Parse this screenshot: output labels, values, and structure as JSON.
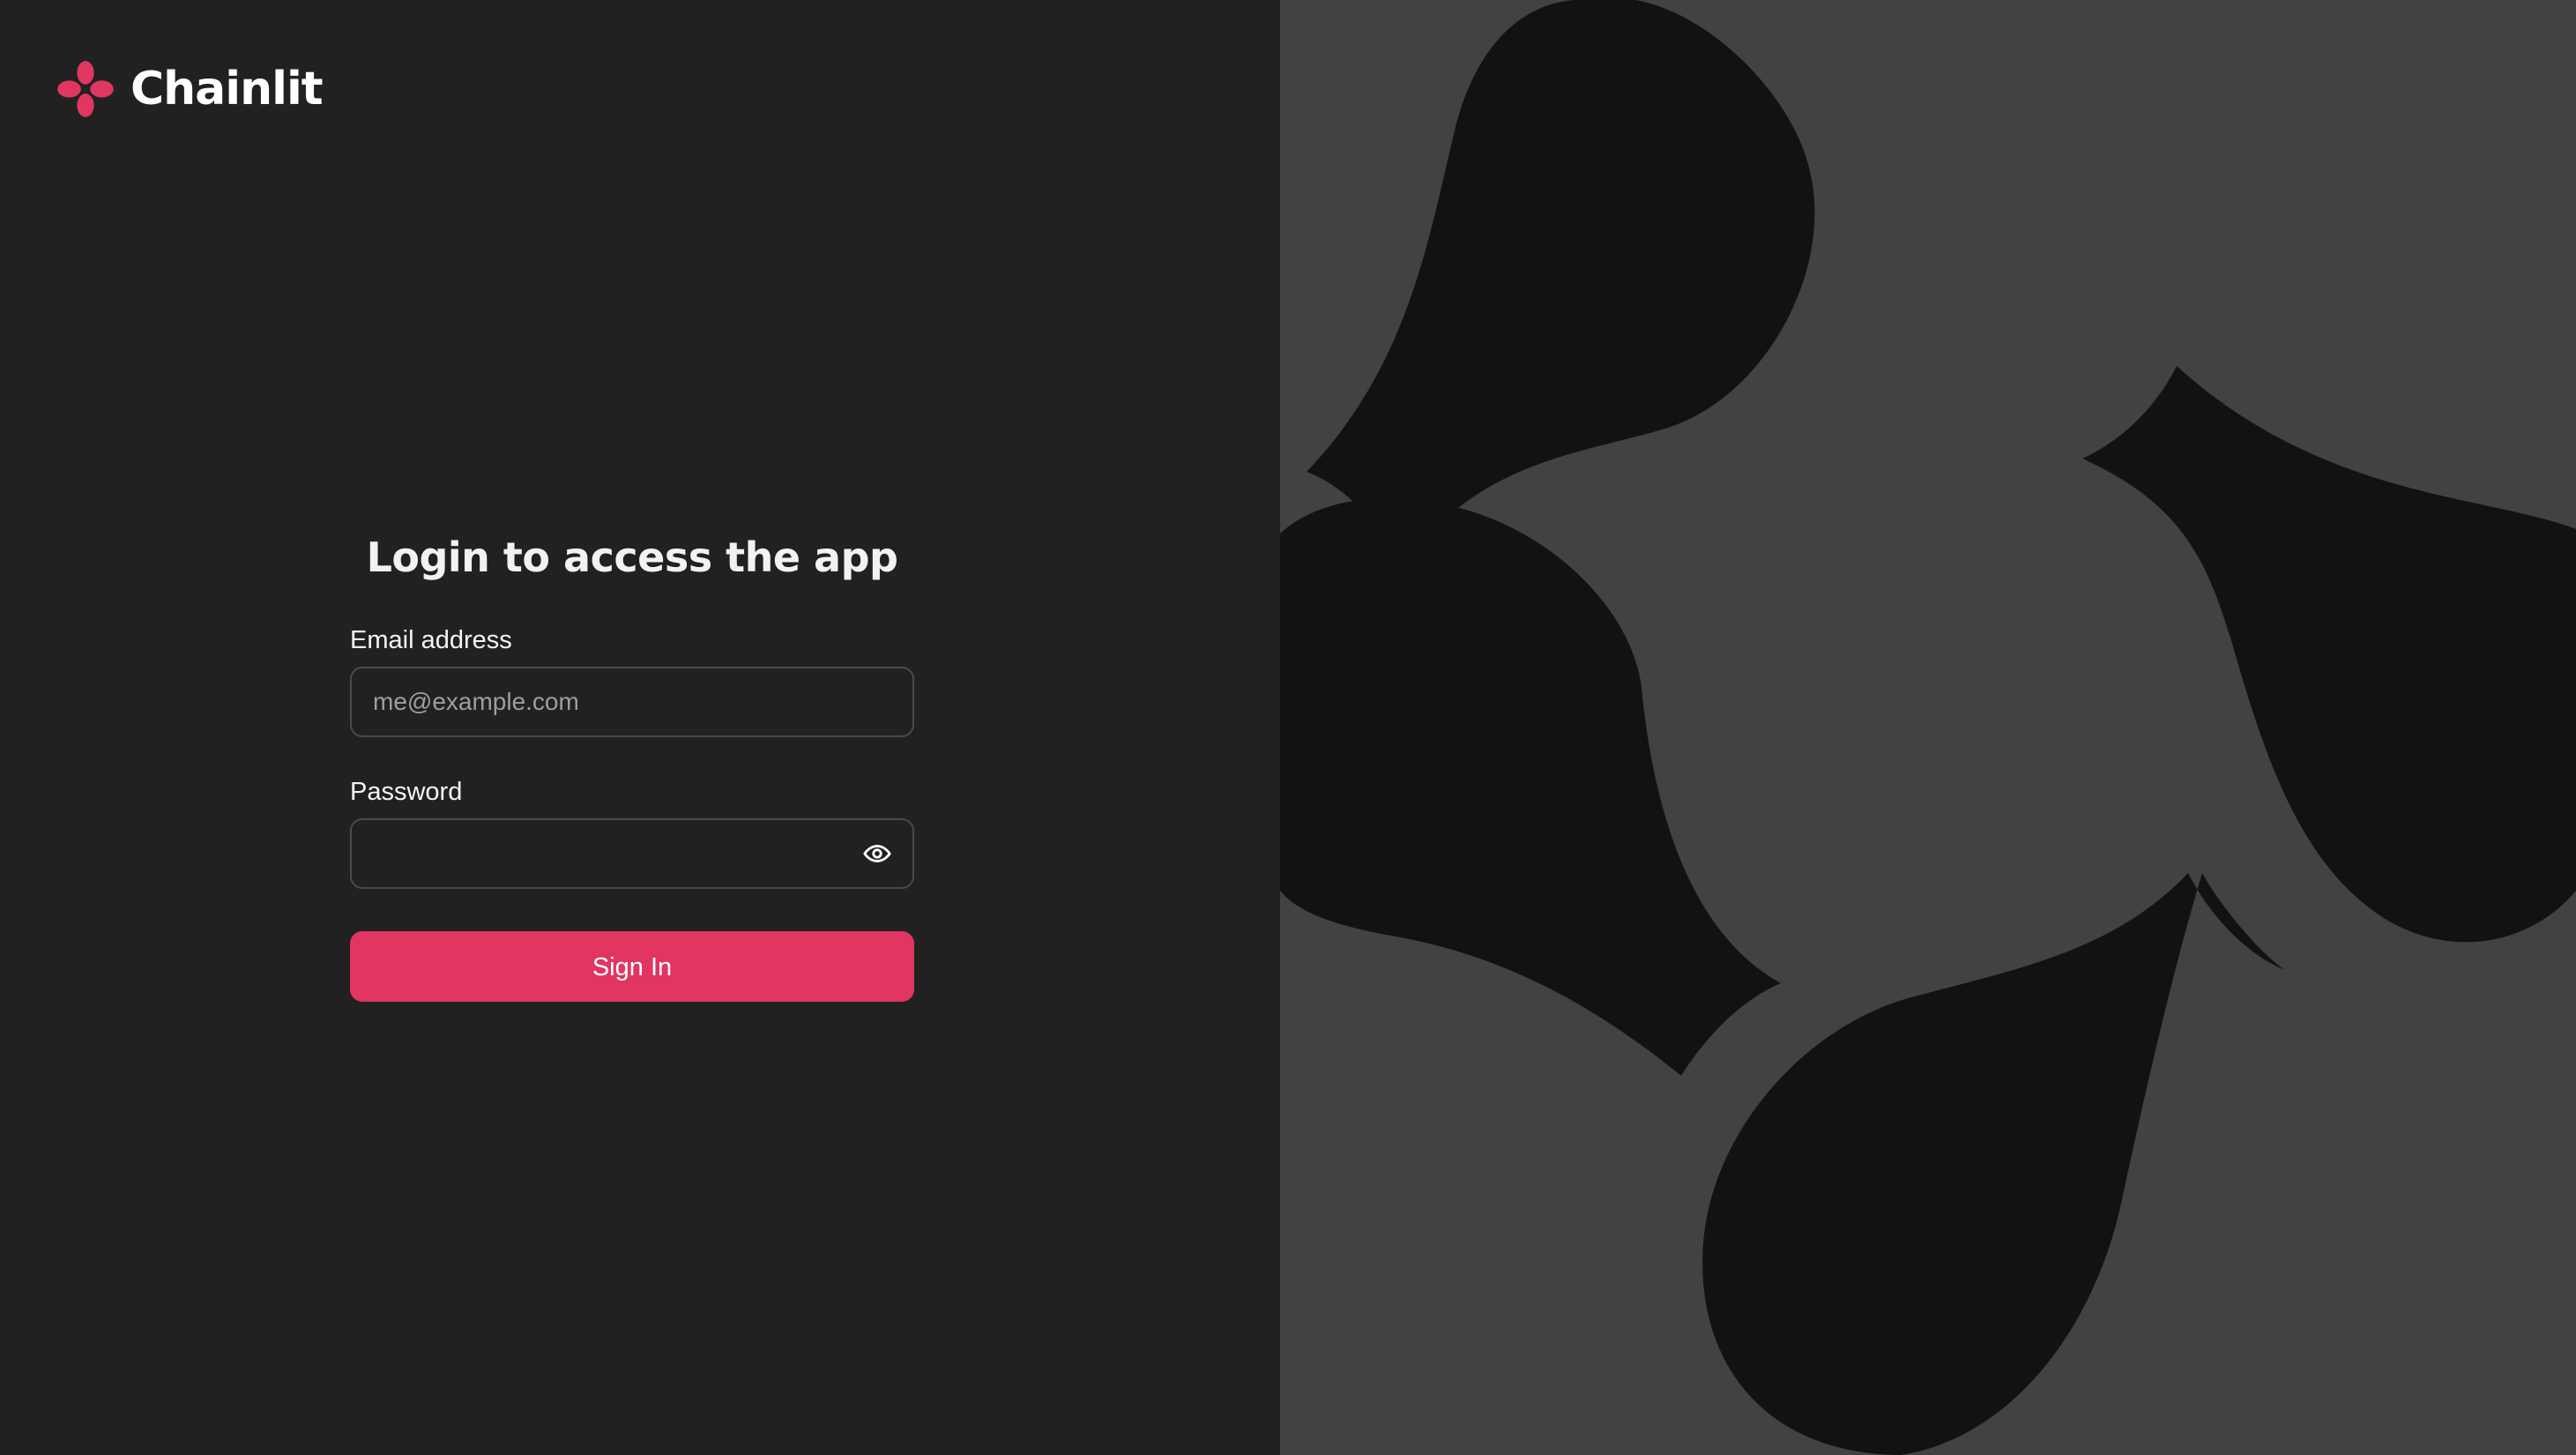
{
  "brand": {
    "name": "Chainlit",
    "logo_icon": "chainlit-logo-icon",
    "accent_color": "#e03661"
  },
  "login": {
    "title": "Login to access the app",
    "email": {
      "label": "Email address",
      "value": "",
      "placeholder": "me@example.com"
    },
    "password": {
      "label": "Password",
      "value": "",
      "placeholder": "",
      "toggle_icon": "eye-icon"
    },
    "submit_label": "Sign In"
  },
  "theme": {
    "left_background": "#212121",
    "right_background": "#424242",
    "art_shape_color": "#121212"
  }
}
